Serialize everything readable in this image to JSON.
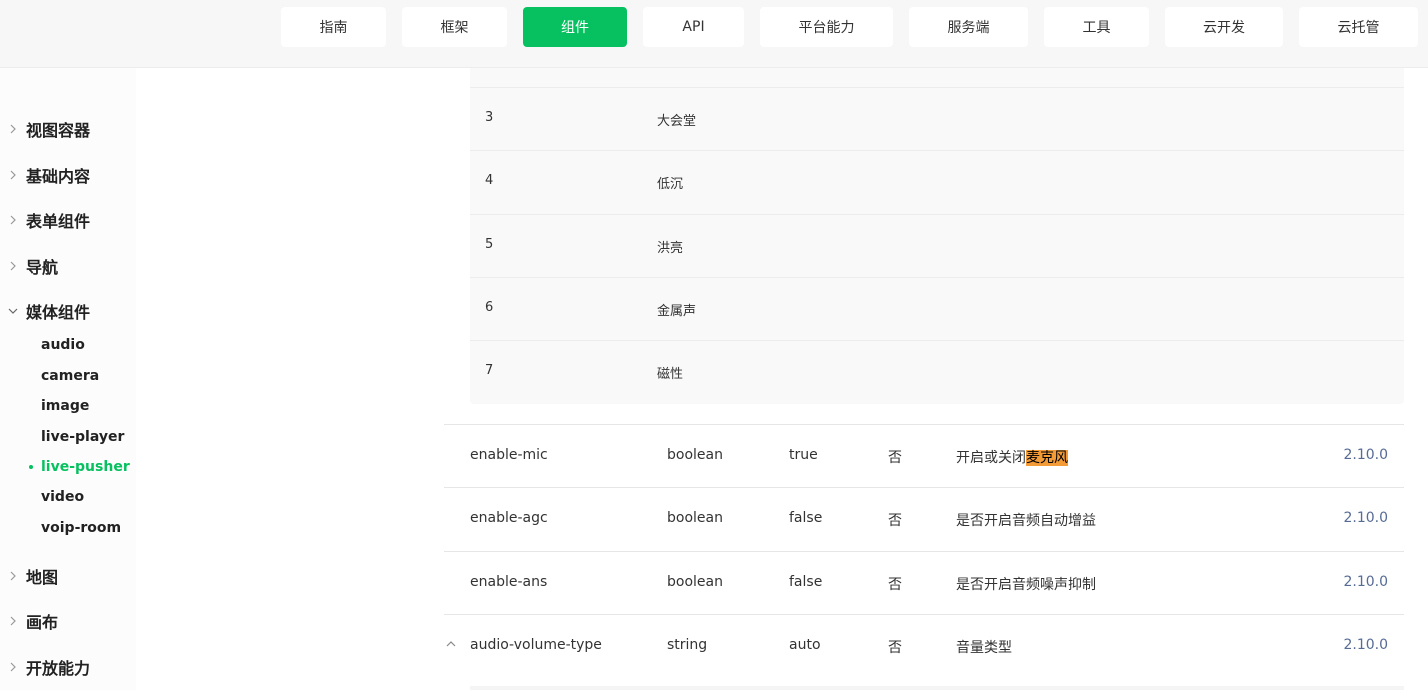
{
  "nav": {
    "tabs": [
      {
        "label": "指南"
      },
      {
        "label": "框架"
      },
      {
        "label": "组件",
        "active": true
      },
      {
        "label": "API"
      },
      {
        "label": "平台能力"
      },
      {
        "label": "服务端"
      },
      {
        "label": "工具"
      },
      {
        "label": "云开发"
      },
      {
        "label": "云托管"
      }
    ]
  },
  "sidebar": {
    "categories": [
      {
        "label": "视图容器",
        "icon": "chevron-right-icon"
      },
      {
        "label": "基础内容",
        "icon": "chevron-right-icon"
      },
      {
        "label": "表单组件",
        "icon": "chevron-right-icon"
      },
      {
        "label": "导航",
        "icon": "chevron-right-icon"
      },
      {
        "label": "媒体组件",
        "icon": "chevron-down-icon",
        "expanded": true
      },
      {
        "label": "地图",
        "icon": "chevron-right-icon"
      },
      {
        "label": "画布",
        "icon": "chevron-right-icon"
      },
      {
        "label": "开放能力",
        "icon": "chevron-right-icon"
      }
    ],
    "media_items": [
      "audio",
      "camera",
      "image",
      "live-player",
      "live-pusher",
      "video",
      "voip-room"
    ],
    "active_item": "live-pusher"
  },
  "inner_table": {
    "rows": [
      {
        "value": "3",
        "desc": "大会堂"
      },
      {
        "value": "4",
        "desc": "低沉"
      },
      {
        "value": "5",
        "desc": "洪亮"
      },
      {
        "value": "6",
        "desc": "金属声"
      },
      {
        "value": "7",
        "desc": "磁性"
      }
    ]
  },
  "props": [
    {
      "name": "enable-mic",
      "type": "boolean",
      "default": "true",
      "required": "否",
      "desc_prefix": "开启或关闭",
      "desc_highlight": "麦克风",
      "version": "2.10.0"
    },
    {
      "name": "enable-agc",
      "type": "boolean",
      "default": "false",
      "required": "否",
      "desc_prefix": "是否开启音频自动增益",
      "desc_highlight": "",
      "version": "2.10.0"
    },
    {
      "name": "enable-ans",
      "type": "boolean",
      "default": "false",
      "required": "否",
      "desc_prefix": "是否开启音频噪声抑制",
      "desc_highlight": "",
      "version": "2.10.0"
    },
    {
      "name": "audio-volume-type",
      "type": "string",
      "default": "auto",
      "required": "否",
      "desc_prefix": "音量类型",
      "desc_highlight": "",
      "version": "2.10.0",
      "expandable": true
    }
  ],
  "colors": {
    "accent": "#07c160",
    "version_link": "#576b95",
    "highlight": "#f39b37"
  }
}
